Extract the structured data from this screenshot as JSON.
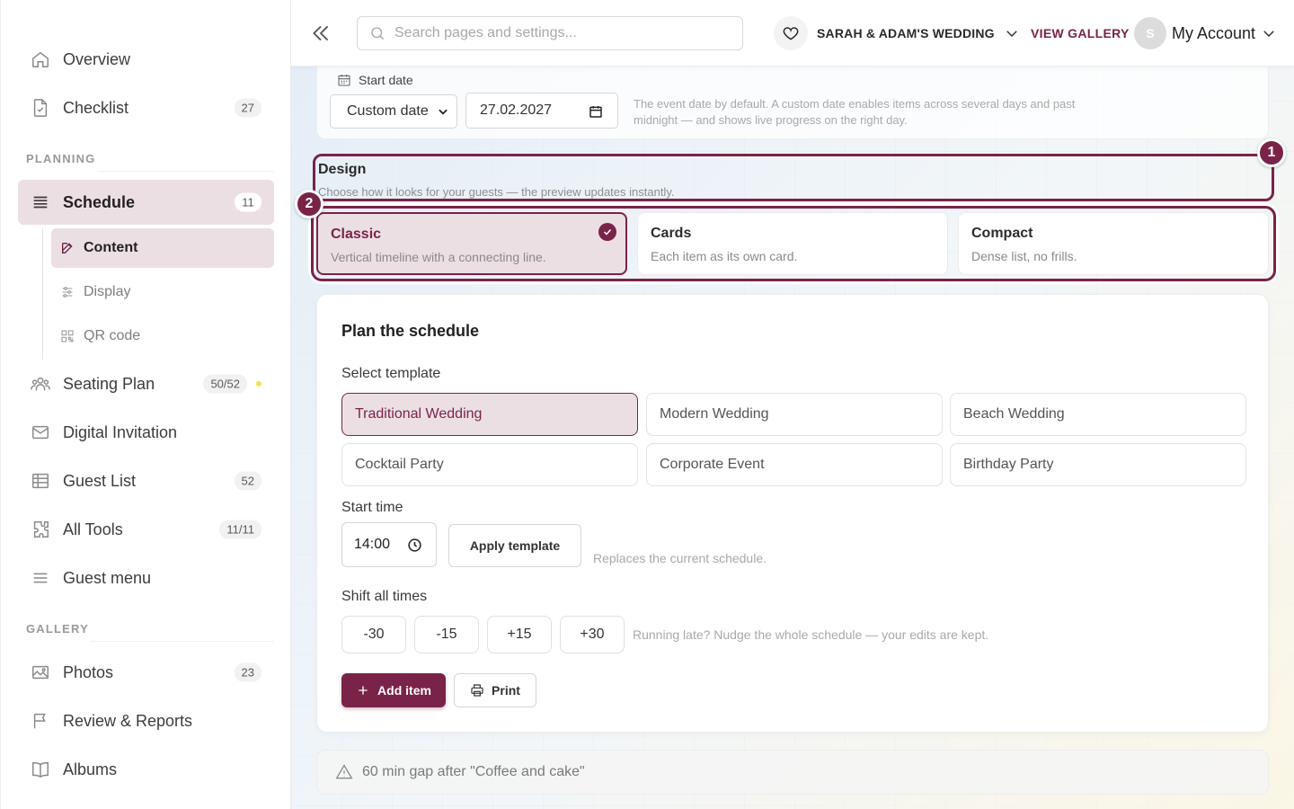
{
  "sidebar": {
    "items_top": [
      {
        "label": "Overview",
        "icon": "home-icon"
      },
      {
        "label": "Checklist",
        "icon": "document-icon",
        "badge": "27"
      }
    ],
    "sections": {
      "planning": "PLANNING",
      "gallery": "GALLERY"
    },
    "schedule": {
      "label": "Schedule",
      "badge": "11",
      "icon": "list-icon"
    },
    "schedule_sub": [
      {
        "label": "Content",
        "icon": "edit-icon"
      },
      {
        "label": "Display",
        "icon": "sliders-icon"
      },
      {
        "label": "QR code",
        "icon": "qr-code-icon"
      }
    ],
    "planning_items": [
      {
        "label": "Seating Plan",
        "badge": "50/52",
        "icon": "people-icon"
      },
      {
        "label": "Digital Invitation",
        "icon": "envelope-icon"
      },
      {
        "label": "Guest List",
        "badge": "52",
        "icon": "table-icon"
      },
      {
        "label": "All Tools",
        "badge": "11/11",
        "icon": "puzzle-icon"
      },
      {
        "label": "Guest menu",
        "icon": "menu-icon"
      }
    ],
    "gallery_items": [
      {
        "label": "Photos",
        "badge": "23",
        "icon": "image-icon"
      },
      {
        "label": "Review & Reports",
        "icon": "flag-icon"
      },
      {
        "label": "Albums",
        "icon": "book-icon"
      }
    ]
  },
  "topbar": {
    "search_placeholder": "Search pages and settings...",
    "event_name": "SARAH & ADAM'S WEDDING",
    "view_gallery": "VIEW GALLERY",
    "avatar_initial": "S",
    "account_label": "My Account"
  },
  "start_date": {
    "label": "Start date",
    "type_value": "Custom date",
    "date_value": "27.02.2027",
    "help": "The event date by default. A custom date enables items across several days and past midnight — and shows live progress on the right day."
  },
  "design": {
    "title": "Design",
    "subtitle": "Choose how it looks for your guests — the preview updates instantly.",
    "options": [
      {
        "title": "Classic",
        "desc": "Vertical timeline with a connecting line."
      },
      {
        "title": "Cards",
        "desc": "Each item as its own card."
      },
      {
        "title": "Compact",
        "desc": "Dense list, no frills."
      }
    ],
    "markers": [
      "1",
      "2"
    ]
  },
  "plan": {
    "title": "Plan the schedule",
    "template_label": "Select template",
    "templates": [
      "Traditional Wedding",
      "Modern Wedding",
      "Beach Wedding",
      "Cocktail Party",
      "Corporate Event",
      "Birthday Party"
    ],
    "start_time_label": "Start time",
    "start_time_value": "14:00",
    "apply_label": "Apply template",
    "apply_help": "Replaces the current schedule.",
    "shift_label": "Shift all times",
    "shifts": [
      "-30",
      "-15",
      "+15",
      "+30"
    ],
    "shift_help": "Running late? Nudge the whole schedule — your edits are kept.",
    "add_label": "Add item",
    "print_label": "Print"
  },
  "warning": {
    "text": "60 min gap after \"Coffee and cake\""
  },
  "colors": {
    "accent": "#7a2348",
    "accent_soft": "#ecdfe4",
    "status_dot": "#f3e24a"
  }
}
